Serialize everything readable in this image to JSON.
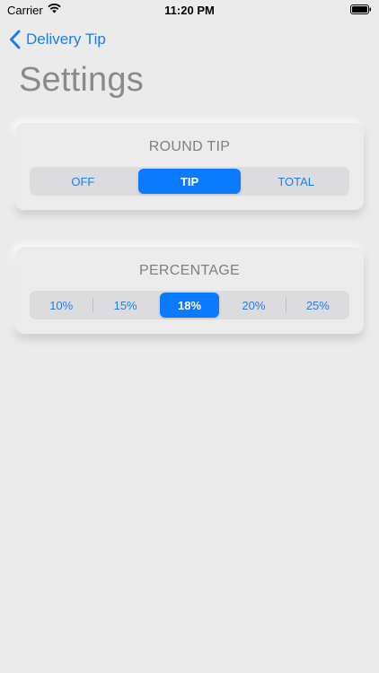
{
  "status_bar": {
    "carrier": "Carrier",
    "time": "11:20 PM"
  },
  "nav": {
    "back_label": "Delivery Tip"
  },
  "page": {
    "title": "Settings"
  },
  "round_tip": {
    "title": "ROUND TIP",
    "options": [
      "OFF",
      "TIP",
      "TOTAL"
    ],
    "selected": "TIP"
  },
  "percentage": {
    "title": "PERCENTAGE",
    "options": [
      "10%",
      "15%",
      "18%",
      "20%",
      "25%"
    ],
    "selected": "18%"
  },
  "colors": {
    "accent": "#0a7aff",
    "link": "#1f7ee6",
    "background": "#ebebeb"
  }
}
